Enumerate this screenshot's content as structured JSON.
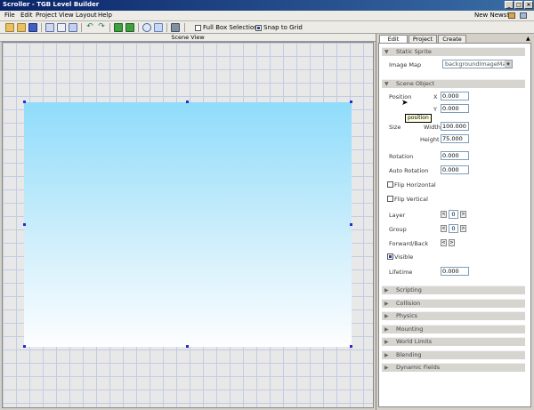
{
  "window": {
    "title": "Scroller - TGB Level Builder"
  },
  "menu": {
    "items": [
      "File",
      "Edit",
      "Project",
      "View",
      "Layout",
      "Help"
    ],
    "news": "New News!"
  },
  "toolbar": {
    "full_box_selection": "Full Box Selection",
    "snap_to_grid": "Snap to Grid"
  },
  "scene": {
    "header": "Scene View"
  },
  "panel": {
    "tabs": [
      "Edit",
      "Project",
      "Create"
    ],
    "static_sprite": {
      "title": "Static Sprite",
      "image_map_label": "Image Map",
      "image_map_value": "backgroundImageMap"
    },
    "scene_object": {
      "title": "Scene Object",
      "position_label": "Position",
      "x_label": "X",
      "x_value": "0.000",
      "y_label": "Y",
      "y_value": "0.000",
      "tooltip": "position",
      "size_label": "Size",
      "width_label": "Width",
      "width_value": "100.000",
      "height_label": "Height",
      "height_value": "75.000",
      "rotation_label": "Rotation",
      "rotation_value": "0.000",
      "auto_rotation_label": "Auto Rotation",
      "auto_rotation_value": "0.000",
      "flip_h_label": "Flip Horizontal",
      "flip_v_label": "Flip Vertical",
      "layer_label": "Layer",
      "layer_value": "0",
      "group_label": "Group",
      "group_value": "0",
      "fb_label": "Forward/Back",
      "visible_label": "Visible",
      "lifetime_label": "Lifetime",
      "lifetime_value": "0.000"
    },
    "collapsed_sections": [
      "Scripting",
      "Collision",
      "Physics",
      "Mounting",
      "World Limits",
      "Blending",
      "Dynamic Fields"
    ]
  },
  "colors": {
    "title_bar": "#0a246a",
    "sprite_top": "#8fdcfb",
    "sprite_bottom": "#fdfeff",
    "grid": "#c2cce4"
  }
}
